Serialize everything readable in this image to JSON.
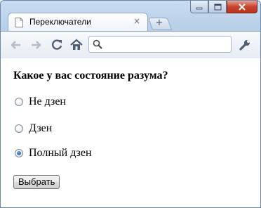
{
  "browser": {
    "tab_title": "Переключатели",
    "tab_close": "×",
    "new_tab": "+",
    "address_value": ""
  },
  "form": {
    "question": "Какое у вас состояние разума?",
    "options": [
      {
        "label": "Не дзен",
        "checked": false
      },
      {
        "label": "Дзен",
        "checked": false
      },
      {
        "label": "Полный дзен",
        "checked": true
      }
    ],
    "submit_label": "Выбрать"
  },
  "colors": {
    "frame": "#b7cfe9",
    "radio_checked": "#1c4f8c",
    "close_button": "#c8442e"
  }
}
